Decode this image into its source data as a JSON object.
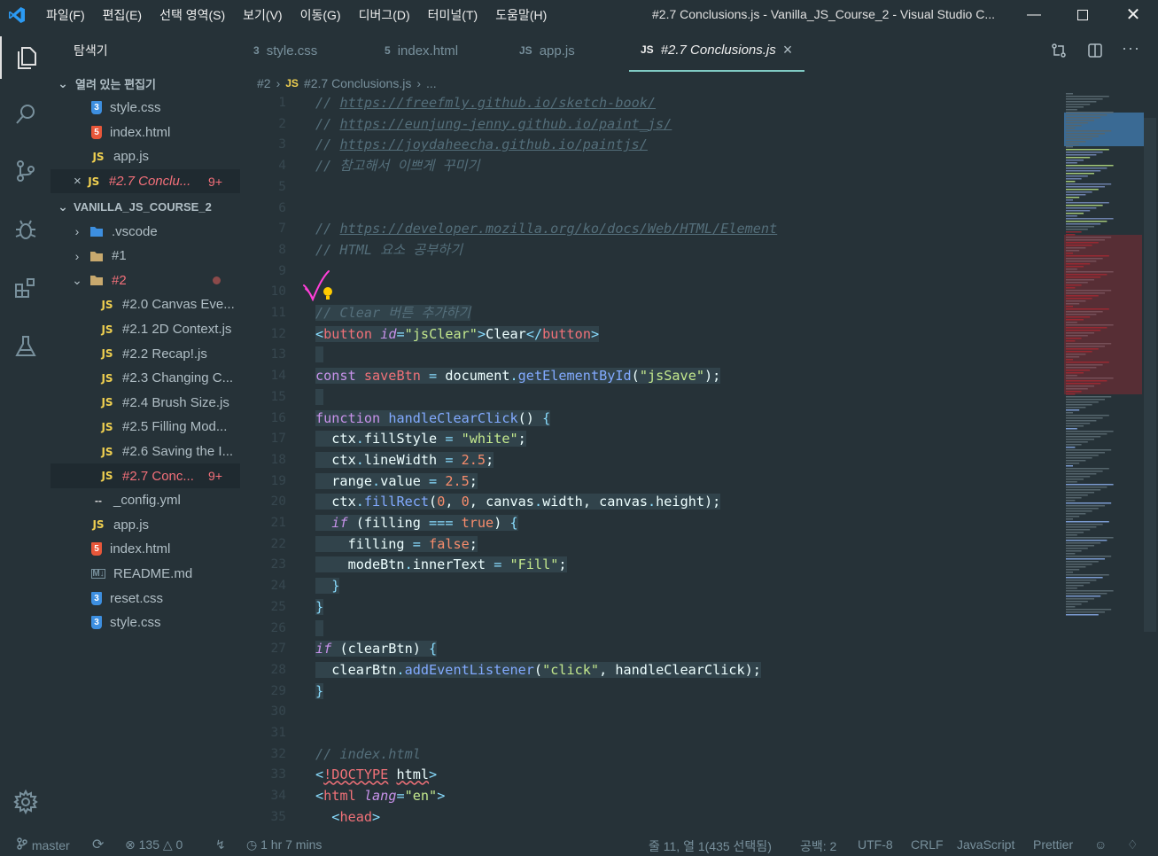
{
  "menu": [
    "파일(F)",
    "편집(E)",
    "선택 영역(S)",
    "보기(V)",
    "이동(G)",
    "디버그(D)",
    "터미널(T)",
    "도움말(H)"
  ],
  "window_title": "#2.7 Conclusions.js - Vanilla_JS_Course_2 - Visual Studio C...",
  "sidebar": {
    "title": "탐색기",
    "open_editors_label": "열려 있는 편집기",
    "open_editors": [
      {
        "icon": "css",
        "label": "style.css"
      },
      {
        "icon": "html",
        "label": "index.html"
      },
      {
        "icon": "js",
        "label": "app.js"
      },
      {
        "icon": "js",
        "label": "#2.7 Conclu...",
        "badge": "9+",
        "error": true,
        "selected": true,
        "close": "×"
      }
    ],
    "project_label": "VANILLA_JS_COURSE_2",
    "tree": [
      {
        "label": ".vscode",
        "indent": 1,
        "chev": "›",
        "folder": "vscode"
      },
      {
        "label": "#1",
        "indent": 1,
        "chev": "›",
        "folder": "plain"
      },
      {
        "label": "#2",
        "indent": 1,
        "chev": "⌄",
        "folder": "open",
        "error": true,
        "dot": true
      },
      {
        "label": "#2.0 Canvas Eve...",
        "indent": 2,
        "icon": "js"
      },
      {
        "label": "#2.1 2D Context.js",
        "indent": 2,
        "icon": "js"
      },
      {
        "label": "#2.2 Recap!.js",
        "indent": 2,
        "icon": "js"
      },
      {
        "label": "#2.3 Changing C...",
        "indent": 2,
        "icon": "js"
      },
      {
        "label": "#2.4 Brush Size.js",
        "indent": 2,
        "icon": "js"
      },
      {
        "label": "#2.5 Filling Mod...",
        "indent": 2,
        "icon": "js"
      },
      {
        "label": "#2.6 Saving the I...",
        "indent": 2,
        "icon": "js"
      },
      {
        "label": "#2.7 Conc...",
        "indent": 2,
        "icon": "js",
        "error": true,
        "badge": "9+",
        "selected": true
      },
      {
        "label": "_config.yml",
        "indent": 1,
        "icon": "yml"
      },
      {
        "label": "app.js",
        "indent": 1,
        "icon": "js"
      },
      {
        "label": "index.html",
        "indent": 1,
        "icon": "html"
      },
      {
        "label": "README.md",
        "indent": 1,
        "icon": "md"
      },
      {
        "label": "reset.css",
        "indent": 1,
        "icon": "css"
      },
      {
        "label": "style.css",
        "indent": 1,
        "icon": "css"
      }
    ]
  },
  "tabs": [
    {
      "icon": "css",
      "label": "style.css"
    },
    {
      "icon": "html",
      "label": "index.html"
    },
    {
      "icon": "js",
      "label": "app.js"
    },
    {
      "icon": "js",
      "label": "#2.7 Conclusions.js",
      "active": true,
      "close": "×"
    }
  ],
  "breadcrumb": [
    "#2",
    "›",
    "JS",
    "#2.7 Conclusions.js",
    "›",
    "..."
  ],
  "code_lines": [
    {
      "n": 1,
      "html": "<span class='c'>// <span class='u'>https://freefmly.github.io/sketch-book/</span></span>"
    },
    {
      "n": 2,
      "html": "<span class='c'>// <span class='u'>https://eunjung-jenny.github.io/paint_js/</span></span>"
    },
    {
      "n": 3,
      "html": "<span class='c'>// <span class='u'>https://joydaheecha.github.io/paintjs/</span></span>"
    },
    {
      "n": 4,
      "html": "<span class='c'>// 참고해서 이쁘게 꾸미기</span>"
    },
    {
      "n": 5,
      "html": ""
    },
    {
      "n": 6,
      "html": ""
    },
    {
      "n": 7,
      "html": "<span class='c'>// <span class='u'>https://developer.mozilla.org/ko/docs/Web/HTML/Element</span></span>"
    },
    {
      "n": 8,
      "html": "<span class='c'>// HTML 요소 공부하기</span>"
    },
    {
      "n": 9,
      "html": ""
    },
    {
      "n": 10,
      "html": ""
    },
    {
      "n": 11,
      "html": "<span class='hl'><span class='c'>// Clear 버튼 추가하기</span></span>"
    },
    {
      "n": 12,
      "html": "<span class='hl'><span class='pu'>&lt;</span><span class='tag'>button</span> <span class='at'>id</span><span class='pu'>=</span><span class='s'>\"jsClear\"</span><span class='pu'>&gt;</span>Clear<span class='pu'>&lt;/</span><span class='tag'>button</span><span class='pu'>&gt;</span></span>"
    },
    {
      "n": 13,
      "html": "<span class='hl'> </span>"
    },
    {
      "n": 14,
      "html": "<span class='hl'><span class='k'>const</span> <span class='tag'>saveBtn</span> <span class='op'>=</span> document<span class='op'>.</span><span class='f'>getElementById</span>(<span class='s'>\"jsSave\"</span>);</span>"
    },
    {
      "n": 15,
      "html": "<span class='hl'> </span>"
    },
    {
      "n": 16,
      "html": "<span class='hl'><span class='k'>function</span> <span class='f'>handleClearClick</span>() <span class='pu'>{</span></span>"
    },
    {
      "n": 17,
      "html": "<span class='hl'>  ctx<span class='op'>.</span>fillStyle <span class='op'>=</span> <span class='s'>\"white\"</span>;</span>"
    },
    {
      "n": 18,
      "html": "<span class='hl'>  ctx<span class='op'>.</span>lineWidth <span class='op'>=</span> <span class='n'>2.5</span>;</span>"
    },
    {
      "n": 19,
      "html": "<span class='hl'>  range<span class='op'>.</span>value <span class='op'>=</span> <span class='n'>2.5</span>;</span>"
    },
    {
      "n": 20,
      "html": "<span class='hl'>  ctx<span class='op'>.</span><span class='f'>fillRect</span>(<span class='n'>0</span>, <span class='n'>0</span>, canvas<span class='op'>.</span>width, canvas<span class='op'>.</span>height);</span>"
    },
    {
      "n": 21,
      "html": "<span class='hl'>  <span class='ki'>if</span> (filling <span class='op'>===</span> <span class='n'>true</span>) <span class='pu'>{</span></span>"
    },
    {
      "n": 22,
      "html": "<span class='hl'>    filling <span class='op'>=</span> <span class='n'>false</span>;</span>"
    },
    {
      "n": 23,
      "html": "<span class='hl'>    modeBtn<span class='op'>.</span>innerText <span class='op'>=</span> <span class='s'>\"Fill\"</span>;</span>"
    },
    {
      "n": 24,
      "html": "<span class='hl'>  <span class='pu'>}</span></span>"
    },
    {
      "n": 25,
      "html": "<span class='hl'><span class='pu'>}</span></span>"
    },
    {
      "n": 26,
      "html": "<span class='hl'> </span>"
    },
    {
      "n": 27,
      "html": "<span class='hl'><span class='ki'>if</span> (clearBtn) <span class='pu'>{</span></span>"
    },
    {
      "n": 28,
      "html": "<span class='hl'>  clearBtn<span class='op'>.</span><span class='f'>addEventListener</span>(<span class='s'>\"click\"</span>, handleClearClick);</span>"
    },
    {
      "n": 29,
      "html": "<span class='hl'><span class='pu'>}</span></span>"
    },
    {
      "n": 30,
      "html": ""
    },
    {
      "n": 31,
      "html": ""
    },
    {
      "n": 32,
      "html": "<span class='c'>// index.html</span>"
    },
    {
      "n": 33,
      "html": "<span class='pu'>&lt;</span><span class='tag sq'>!DOCTYPE</span> <span class='sq'>html</span><span class='pu'>&gt;</span>"
    },
    {
      "n": 34,
      "html": "<span class='pu'>&lt;</span><span class='tag'>html</span> <span class='at'>lang</span><span class='pu'>=</span><span class='s'>\"en\"</span><span class='pu'>&gt;</span>"
    },
    {
      "n": 35,
      "html": "  <span class='pu'>&lt;</span><span class='tag'>head</span><span class='pu'>&gt;</span>"
    }
  ],
  "status": {
    "branch": "master",
    "errors": "135",
    "warnings": "0",
    "time": "1 hr 7 mins",
    "position": "줄 11, 열 1(435 선택됨)",
    "spaces": "공백: 2",
    "encoding": "UTF-8",
    "eol": "CRLF",
    "language": "JavaScript",
    "formatter": "Prettier"
  },
  "colors": {
    "accent": "#80cbc4",
    "error": "#f4707a",
    "bg": "#263238"
  }
}
